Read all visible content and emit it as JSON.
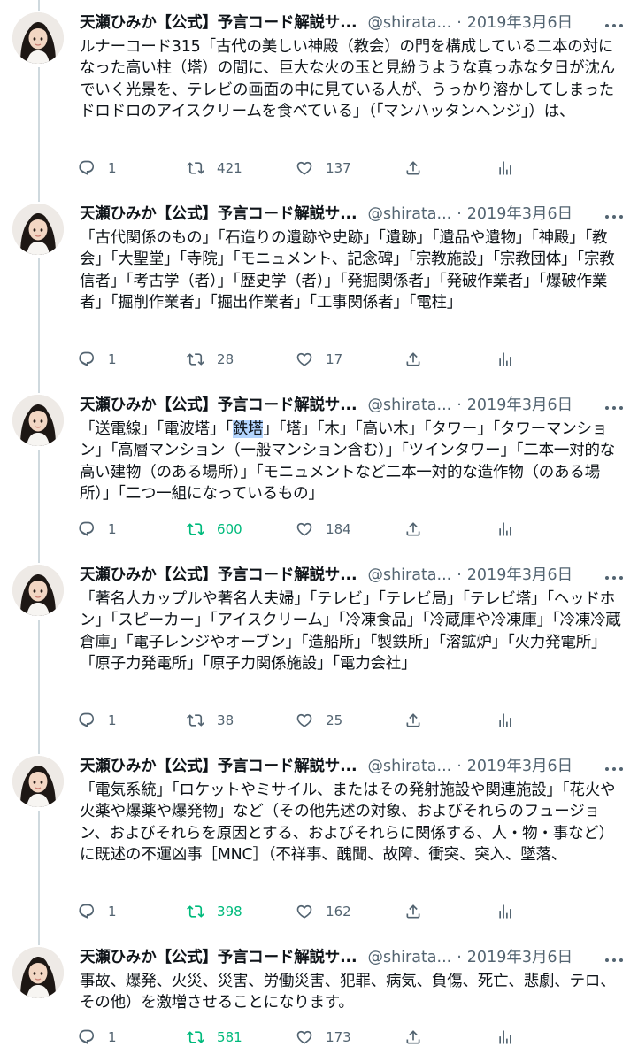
{
  "colors": {
    "text": "#0f1419",
    "secondary": "#536471",
    "retweet_active": "#00ba7c",
    "thread_line": "#cfd9de",
    "highlight": "#b4d5fe"
  },
  "tweets": [
    {
      "name": "天瀬ひみか【公式】予言コード解説サ...",
      "handle": "@shirata...",
      "sep": "·",
      "date": "2019年3月6日",
      "text": "ルナーコード315「古代の美しい神殿（教会）の門を構成している二本の対になった高い柱（塔）の間に、巨大な火の玉と見紛うような真っ赤な夕日が沈んでいく光景を、テレビの画面の中に見ている人が、うっかり溶かしてしまったドロドロのアイスクリームを食べている」（「マンハッタンヘンジ」）は、",
      "replies": "1",
      "retweets": "421",
      "likes": "137",
      "retweeted": false
    },
    {
      "name": "天瀬ひみか【公式】予言コード解説サ...",
      "handle": "@shirata...",
      "sep": "·",
      "date": "2019年3月6日",
      "text": "「古代関係のもの」「石造りの遺跡や史跡」「遺跡」「遺品や遺物」「神殿」「教会」「大聖堂」「寺院」「モニュメント、記念碑」「宗教施設」「宗教団体」「宗教信者」「考古学（者）」「歴史学（者）」「発掘関係者」「発破作業者」「爆破作業者」「掘削作業者」「掘出作業者」「工事関係者」「電柱」",
      "replies": "1",
      "retweets": "28",
      "likes": "17",
      "retweeted": false
    },
    {
      "name": "天瀬ひみか【公式】予言コード解説サ...",
      "handle": "@shirata...",
      "sep": "·",
      "date": "2019年3月6日",
      "text_before": "「送電線」「電波塔」「",
      "text_highlight": "鉄塔",
      "text_after": "」「塔」「木」「高い木」「タワー」「タワーマンション」「高層マンション（一般マンション含む）」「ツインタワー」「二本一対的な高い建物（のある場所）」「モニュメントなど二本一対的な造作物（のある場所）」「二つ一組になっているもの」",
      "replies": "1",
      "retweets": "600",
      "likes": "184",
      "retweeted": true
    },
    {
      "name": "天瀬ひみか【公式】予言コード解説サ...",
      "handle": "@shirata...",
      "sep": "·",
      "date": "2019年3月6日",
      "text": "「著名人カップルや著名人夫婦」「テレビ」「テレビ局」「テレビ塔」「ヘッドホン」「スピーカー」「アイスクリーム」「冷凍食品」「冷蔵庫や冷凍庫」「冷凍冷蔵倉庫」「電子レンジやオーブン」「造船所」「製鉄所」「溶鉱炉」「火力発電所」「原子力発電所」「原子力関係施設」「電力会社」",
      "replies": "1",
      "retweets": "38",
      "likes": "25",
      "retweeted": false
    },
    {
      "name": "天瀬ひみか【公式】予言コード解説サ...",
      "handle": "@shirata...",
      "sep": "·",
      "date": "2019年3月6日",
      "text": "「電気系統」「ロケットやミサイル、またはその発射施設や関連施設」「花火や火薬や爆薬や爆発物」など（その他先述の対象、およびそれらのフュージョン、およびそれらを原因とする、およびそれらに関係する、人・物・事など）に既述の不運凶事［MNC］（不祥事、醜聞、故障、衝突、突入、墜落、",
      "replies": "1",
      "retweets": "398",
      "likes": "162",
      "retweeted": true
    },
    {
      "name": "天瀬ひみか【公式】予言コード解説サ...",
      "handle": "@shirata...",
      "sep": "·",
      "date": "2019年3月6日",
      "text": "事故、爆発、火災、災害、労働災害、犯罪、病気、負傷、死亡、悲劇、テロ、その他）を激増させることになります。",
      "replies": "1",
      "retweets": "581",
      "likes": "173",
      "retweeted": true
    }
  ]
}
